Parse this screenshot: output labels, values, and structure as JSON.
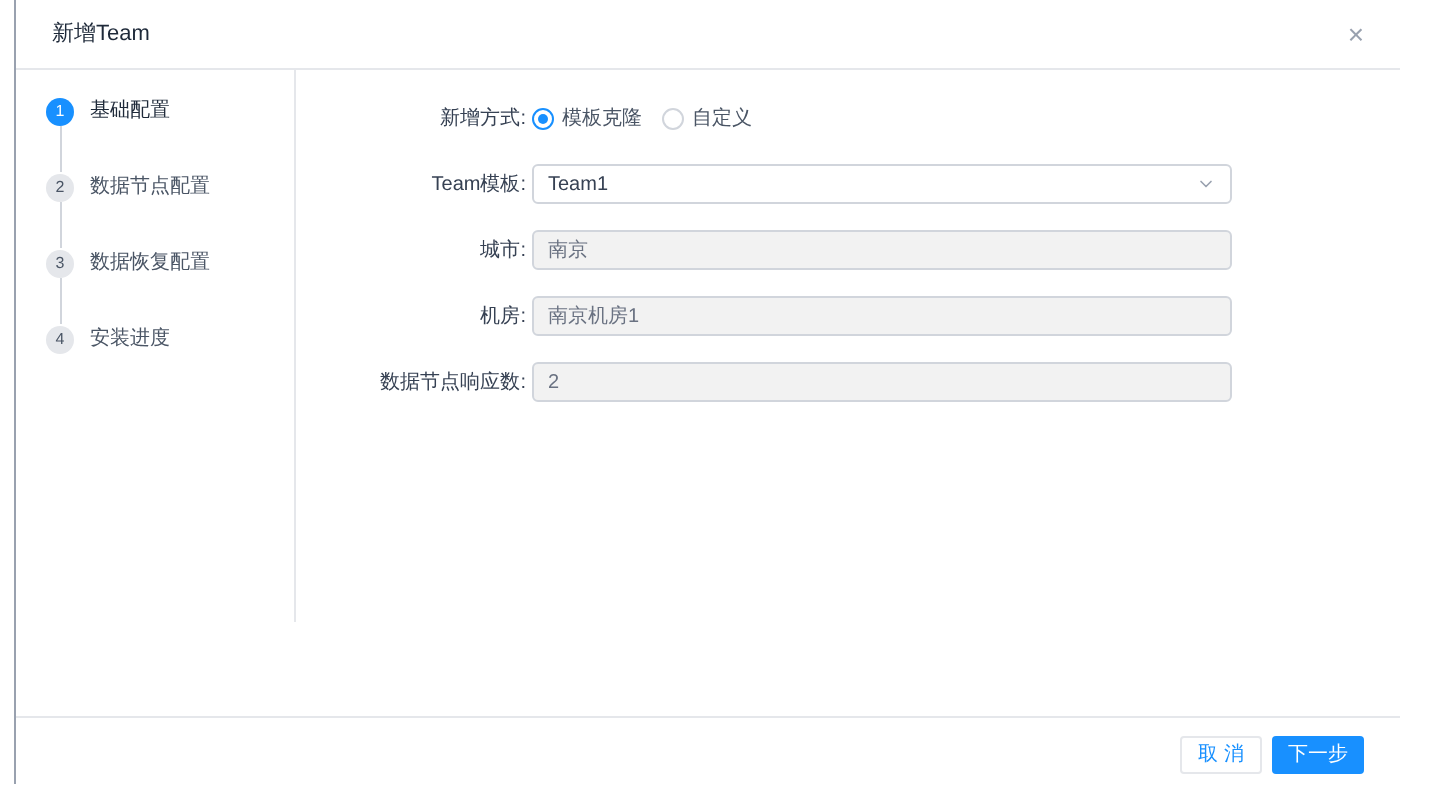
{
  "dialog": {
    "title": "新增Team",
    "close": "×"
  },
  "steps": [
    {
      "number": "1",
      "label": "基础配置",
      "selected": true
    },
    {
      "number": "2",
      "label": "数据节点配置",
      "selected": false
    },
    {
      "number": "3",
      "label": "数据恢复配置",
      "selected": false
    },
    {
      "number": "4",
      "label": "安装进度",
      "selected": false
    }
  ],
  "form": {
    "mode": {
      "label": "新增方式:",
      "options": [
        {
          "label": "模板克隆",
          "selected": true
        },
        {
          "label": "自定义",
          "selected": false
        }
      ]
    },
    "fields": [
      {
        "kind": "select",
        "label": "Team模板:",
        "value": "Team1",
        "disabled": false
      },
      {
        "kind": "input",
        "label": "城市:",
        "value": "南京",
        "disabled": true
      },
      {
        "kind": "input",
        "label": "机房:",
        "value": "南京机房1",
        "disabled": true
      },
      {
        "kind": "input",
        "label": "数据节点响应数:",
        "value": "2",
        "disabled": true
      }
    ]
  },
  "buttons": [
    {
      "label": "取 消",
      "kind": "default"
    },
    {
      "label": "下一步",
      "kind": "primary"
    }
  ]
}
